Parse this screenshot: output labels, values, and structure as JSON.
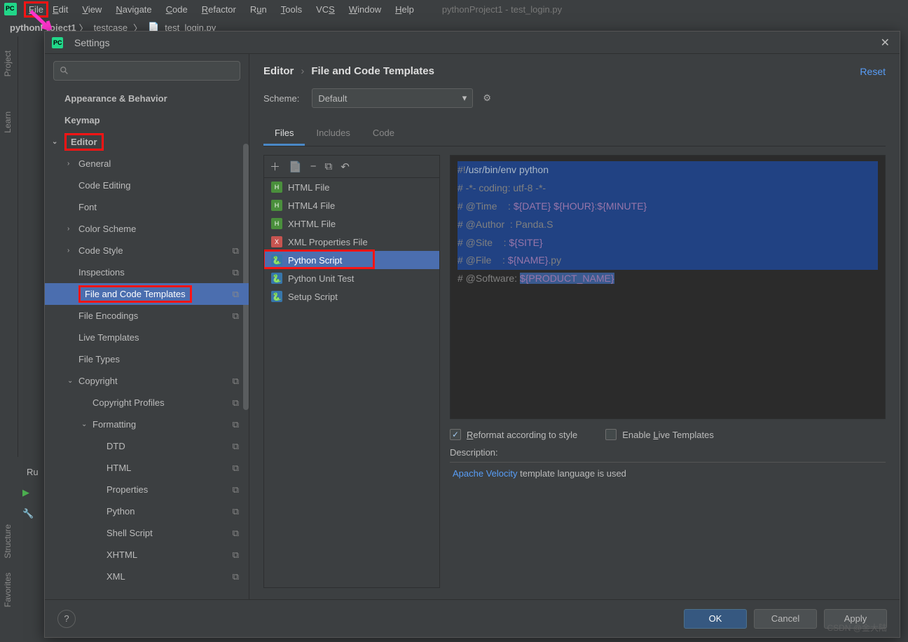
{
  "menu": [
    "File",
    "Edit",
    "View",
    "Navigate",
    "Code",
    "Refactor",
    "Run",
    "Tools",
    "VCS",
    "Window",
    "Help"
  ],
  "window_title": "pythonProject1 - test_login.py",
  "breadcrumb": {
    "project": "pythonProject1",
    "folder": "testcase",
    "file": "test_login.py"
  },
  "left_tabs": [
    "Project",
    "Learn",
    "Structure",
    "Favorites"
  ],
  "dialog": {
    "title": "Settings",
    "search_placeholder": "",
    "path_root": "Editor",
    "path_leaf": "File and Code Templates",
    "reset": "Reset",
    "scheme_label": "Scheme:",
    "scheme_value": "Default",
    "tabs": [
      "Files",
      "Includes",
      "Code"
    ],
    "toolbar": {
      "add": "＋",
      "copyfile": "📄",
      "remove": "−",
      "copy": "⧉",
      "undo": "↶"
    },
    "templates": [
      "HTML File",
      "HTML4 File",
      "XHTML File",
      "XML Properties File",
      "Python Script",
      "Python Unit Test",
      "Setup Script"
    ],
    "code_lines": [
      "#!/usr/bin/env python",
      "# -*- coding: utf-8 -*-",
      "# @Time    : ${DATE} ${HOUR}:${MINUTE}",
      "# @Author  : Panda.S",
      "# @Site    : ${SITE}",
      "# @File    : ${NAME}.py",
      "# @Software: ${PRODUCT_NAME}"
    ],
    "reformat": "Reformat according to style",
    "enable_live": "Enable Live Templates",
    "description_label": "Description:",
    "desc_link": "Apache Velocity",
    "desc_text": " template language is used",
    "ok": "OK",
    "cancel": "Cancel",
    "apply": "Apply"
  },
  "tree": [
    {
      "label": "Appearance & Behavior",
      "lvl": 1,
      "bold": true
    },
    {
      "label": "Keymap",
      "lvl": 1,
      "bold": true
    },
    {
      "label": "Editor",
      "lvl": 1,
      "bold": true,
      "exp": true,
      "redbox": true
    },
    {
      "label": "General",
      "lvl": 2,
      "chev": "›"
    },
    {
      "label": "Code Editing",
      "lvl": 2
    },
    {
      "label": "Font",
      "lvl": 2
    },
    {
      "label": "Color Scheme",
      "lvl": 2,
      "chev": "›"
    },
    {
      "label": "Code Style",
      "lvl": 2,
      "chev": "›",
      "copy": true
    },
    {
      "label": "Inspections",
      "lvl": 2,
      "copy": true
    },
    {
      "label": "File and Code Templates",
      "lvl": 2,
      "selected": true,
      "redbox": true,
      "copy": true
    },
    {
      "label": "File Encodings",
      "lvl": 2,
      "copy": true
    },
    {
      "label": "Live Templates",
      "lvl": 2
    },
    {
      "label": "File Types",
      "lvl": 2
    },
    {
      "label": "Copyright",
      "lvl": 2,
      "exp": true,
      "copy": true
    },
    {
      "label": "Copyright Profiles",
      "lvl": 3,
      "copy": true
    },
    {
      "label": "Formatting",
      "lvl": 3,
      "exp": true,
      "copy": true
    },
    {
      "label": "DTD",
      "lvl": 4,
      "copy": true
    },
    {
      "label": "HTML",
      "lvl": 4,
      "copy": true
    },
    {
      "label": "Properties",
      "lvl": 4,
      "copy": true
    },
    {
      "label": "Python",
      "lvl": 4,
      "copy": true
    },
    {
      "label": "Shell Script",
      "lvl": 4,
      "copy": true
    },
    {
      "label": "XHTML",
      "lvl": 4,
      "copy": true
    },
    {
      "label": "XML",
      "lvl": 4,
      "copy": true
    }
  ],
  "watermark": "CSDN @金大陆"
}
